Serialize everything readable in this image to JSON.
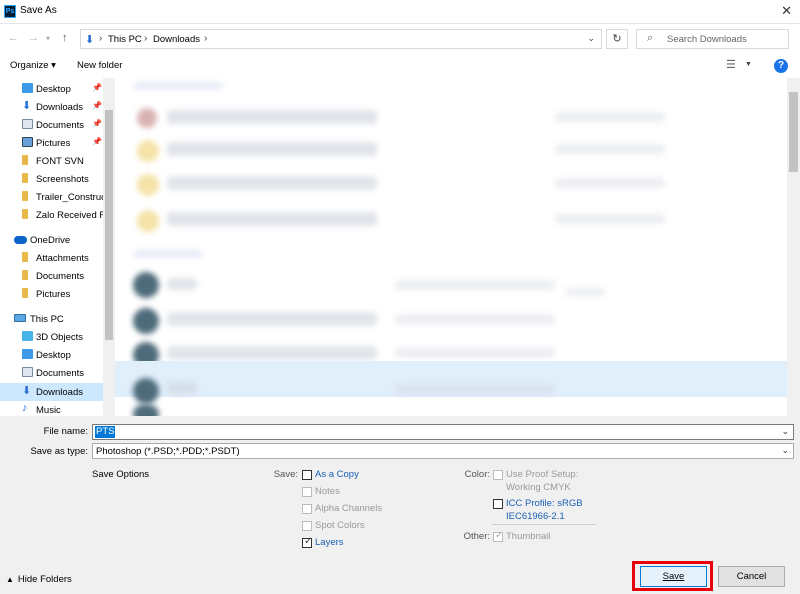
{
  "window": {
    "title": "Save As",
    "app_icon": "Ps",
    "close_glyph": "✕"
  },
  "address": {
    "crumbs": [
      "This PC",
      "Downloads"
    ],
    "search_placeholder": "Search Downloads"
  },
  "toolbar": {
    "organize": "Organize ▾",
    "new_folder": "New folder",
    "help": "?"
  },
  "nav": {
    "items": [
      {
        "label": "Desktop",
        "icon": "desktop-icon",
        "pinned": true
      },
      {
        "label": "Downloads",
        "icon": "downloads-icon",
        "pinned": true
      },
      {
        "label": "Documents",
        "icon": "documents-icon",
        "pinned": true
      },
      {
        "label": "Pictures",
        "icon": "pictures-icon",
        "pinned": true
      },
      {
        "label": "FONT SVN",
        "icon": "folder-icon"
      },
      {
        "label": "Screenshots",
        "icon": "folder-icon"
      },
      {
        "label": "Trailer_Construct",
        "icon": "folder-icon"
      },
      {
        "label": "Zalo Received Fi",
        "icon": "folder-icon"
      },
      {
        "label": "OneDrive",
        "icon": "onedrive-icon"
      },
      {
        "label": "Attachments",
        "icon": "folder-icon"
      },
      {
        "label": "Documents",
        "icon": "folder-icon"
      },
      {
        "label": "Pictures",
        "icon": "folder-icon"
      },
      {
        "label": "This PC",
        "icon": "this-pc-icon"
      },
      {
        "label": "3D Objects",
        "icon": "3d-objects-icon"
      },
      {
        "label": "Desktop",
        "icon": "desktop-icon"
      },
      {
        "label": "Documents",
        "icon": "documents-icon"
      },
      {
        "label": "Downloads",
        "icon": "downloads-icon",
        "selected": true
      },
      {
        "label": "Music",
        "icon": "music-icon"
      }
    ]
  },
  "form": {
    "file_name_label": "File name:",
    "file_name_value": "PTS",
    "save_as_type_label": "Save as type:",
    "save_as_type_value": "Photoshop (*.PSD;*.PDD;*.PSDT)"
  },
  "options": {
    "heading": "Save Options",
    "save_label": "Save:",
    "color_label": "Color:",
    "other_label": "Other:",
    "as_a_copy": "As a Copy",
    "notes": "Notes",
    "alpha_channels": "Alpha Channels",
    "spot_colors": "Spot Colors",
    "layers": "Layers",
    "layers_checked": true,
    "use_proof_setup": "Use Proof Setup:",
    "working_cmyk": "Working CMYK",
    "icc_profile": "ICC Profile:  sRGB",
    "icc_profile_detail": "IEC61966-2.1",
    "thumbnail": "Thumbnail",
    "thumbnail_checked": true
  },
  "footer": {
    "hide_folders": "Hide Folders",
    "save": "Save",
    "cancel": "Cancel"
  },
  "colors": {
    "accent": "#0078d7",
    "highlight_frame": "#e8000b",
    "selection": "#cce8ff"
  }
}
